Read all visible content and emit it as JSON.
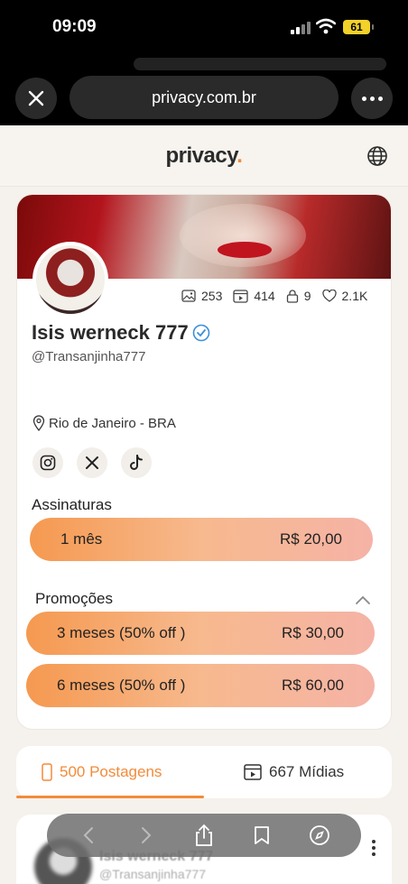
{
  "status_bar": {
    "time": "09:09",
    "battery": "61"
  },
  "browser": {
    "url": "privacy.com.br"
  },
  "site": {
    "logo_text": "privacy",
    "logo_dot": ".",
    "accent_color": "#f28b3a"
  },
  "profile": {
    "stats": {
      "photos": "253",
      "videos": "414",
      "locked": "9",
      "likes": "2.1K"
    },
    "name": "Isis werneck 777",
    "handle": "@Transanjinha777",
    "location": "Rio de Janeiro - BRA",
    "socials": [
      "instagram-icon",
      "x-icon",
      "tiktok-icon"
    ]
  },
  "subscriptions": {
    "title": "Assinaturas",
    "plans": [
      {
        "label": "1 mês",
        "price": "R$ 20,00"
      }
    ]
  },
  "promotions": {
    "title": "Promoções",
    "plans": [
      {
        "label": "3 meses (50% off )",
        "price": "R$ 30,00"
      },
      {
        "label": "6 meses (50% off )",
        "price": "R$ 60,00"
      }
    ]
  },
  "tabs": {
    "posts": "500 Postagens",
    "media": "667 Mídias"
  },
  "post_preview": {
    "name": "Isis werneck 777",
    "handle": "@Transanjinha777"
  }
}
